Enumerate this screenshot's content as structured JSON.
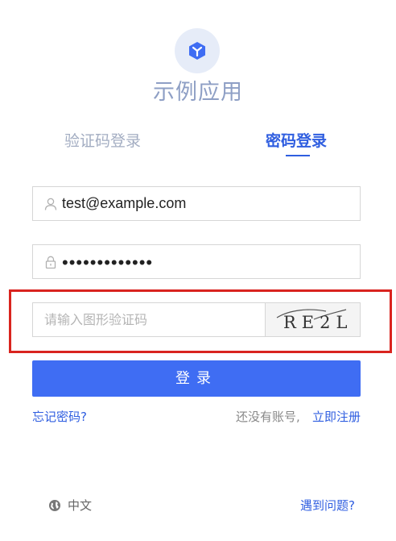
{
  "app": {
    "title": "示例应用",
    "logo_icon": "cube-icon"
  },
  "tabs": {
    "sms_login": "验证码登录",
    "password_login": "密码登录",
    "active": "password_login"
  },
  "form": {
    "username_value": "test@example.com",
    "password_value": "•••••••••••••",
    "captcha_placeholder": "请输入图形验证码",
    "captcha_image_text": "RE2L"
  },
  "actions": {
    "login_label": "登录",
    "forgot_password": "忘记密码?",
    "no_account_text": "还没有账号,",
    "register_now": "立即注册"
  },
  "footer": {
    "language": "中文",
    "help": "遇到问题?"
  },
  "colors": {
    "primary": "#3f6df3",
    "link": "#2f5ee0",
    "highlight": "#d9241f"
  }
}
